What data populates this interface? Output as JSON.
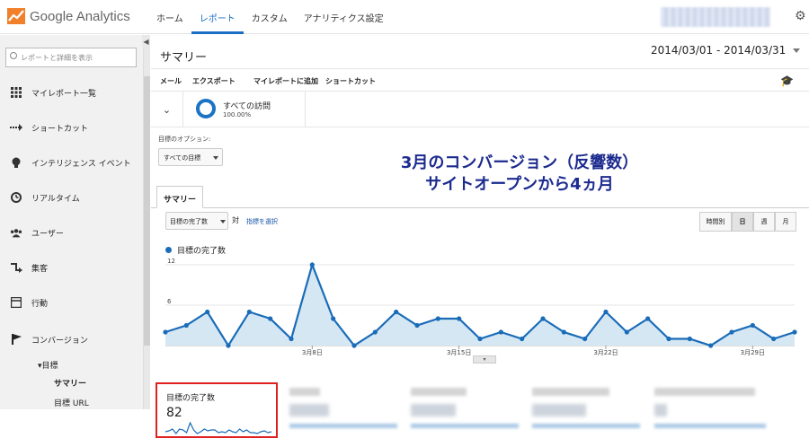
{
  "app": {
    "name": "Google Analytics"
  },
  "nav": {
    "home": "ホーム",
    "reports": "レポート",
    "custom": "カスタム",
    "settings": "アナリティクス設定"
  },
  "sidebar": {
    "search_placeholder": "レポートと詳細を表示",
    "items": [
      {
        "label": "マイレポート一覧",
        "icon": "grid-icon"
      },
      {
        "label": "ショートカット",
        "icon": "shortcut-arrow-icon"
      },
      {
        "label": "インテリジェンス イベント",
        "icon": "lightbulb-icon"
      },
      {
        "label": "リアルタイム",
        "icon": "clock-icon"
      },
      {
        "label": "ユーザー",
        "icon": "users-icon"
      },
      {
        "label": "集客",
        "icon": "acquisition-arrows-icon"
      },
      {
        "label": "行動",
        "icon": "behavior-page-icon"
      },
      {
        "label": "コンバージョン",
        "icon": "flag-icon"
      }
    ],
    "goals_label": "▾目標",
    "summary_label": "サマリー",
    "goal_url_label": "目標 URL"
  },
  "main": {
    "title": "サマリー",
    "date_range": "2014/03/01 - 2014/03/31",
    "toolbar": {
      "email": "メール",
      "export": "エクスポート",
      "add_to_dashboard": "マイレポートに追加",
      "shortcut": "ショートカット"
    },
    "segment": {
      "name": "すべての訪問",
      "percent": "100.00%"
    },
    "goal_option_label": "目標のオプション:",
    "goal_option_value": "すべての目標",
    "annotation_line1": "3月のコンバージョン（反響数）",
    "annotation_line2": "サイトオープンから4ヵ月",
    "tab": "サマリー",
    "metric_select": "目標の完了数",
    "vs": "対",
    "select_metric": "指標を選択",
    "granularity": {
      "hourly": "時間別",
      "day": "日",
      "week": "週",
      "month": "月"
    },
    "scorecard": {
      "name": "目標の完了数",
      "value": "82"
    }
  },
  "chart_data": {
    "type": "area",
    "legend": "目標の完了数",
    "x": [
      1,
      2,
      3,
      4,
      5,
      6,
      7,
      8,
      9,
      10,
      11,
      12,
      13,
      14,
      15,
      16,
      17,
      18,
      19,
      20,
      21,
      22,
      23,
      24,
      25,
      26,
      27,
      28,
      29,
      30,
      31
    ],
    "values": [
      2,
      3,
      5,
      0,
      5,
      4,
      1,
      12,
      4,
      0,
      2,
      5,
      3,
      4,
      4,
      1,
      2,
      1,
      4,
      2,
      1,
      5,
      2,
      4,
      1,
      1,
      0,
      2,
      3,
      1,
      2
    ],
    "yticks": [
      "12",
      "6"
    ],
    "ylim": [
      0,
      12
    ],
    "xticks": [
      {
        "x": 8,
        "label": "3月8日"
      },
      {
        "x": 15,
        "label": "3月15日"
      },
      {
        "x": 22,
        "label": "3月22日"
      },
      {
        "x": 29,
        "label": "3月29日"
      }
    ],
    "colors": {
      "line": "#1a6cb8",
      "fill": "#d6e7f4"
    }
  }
}
